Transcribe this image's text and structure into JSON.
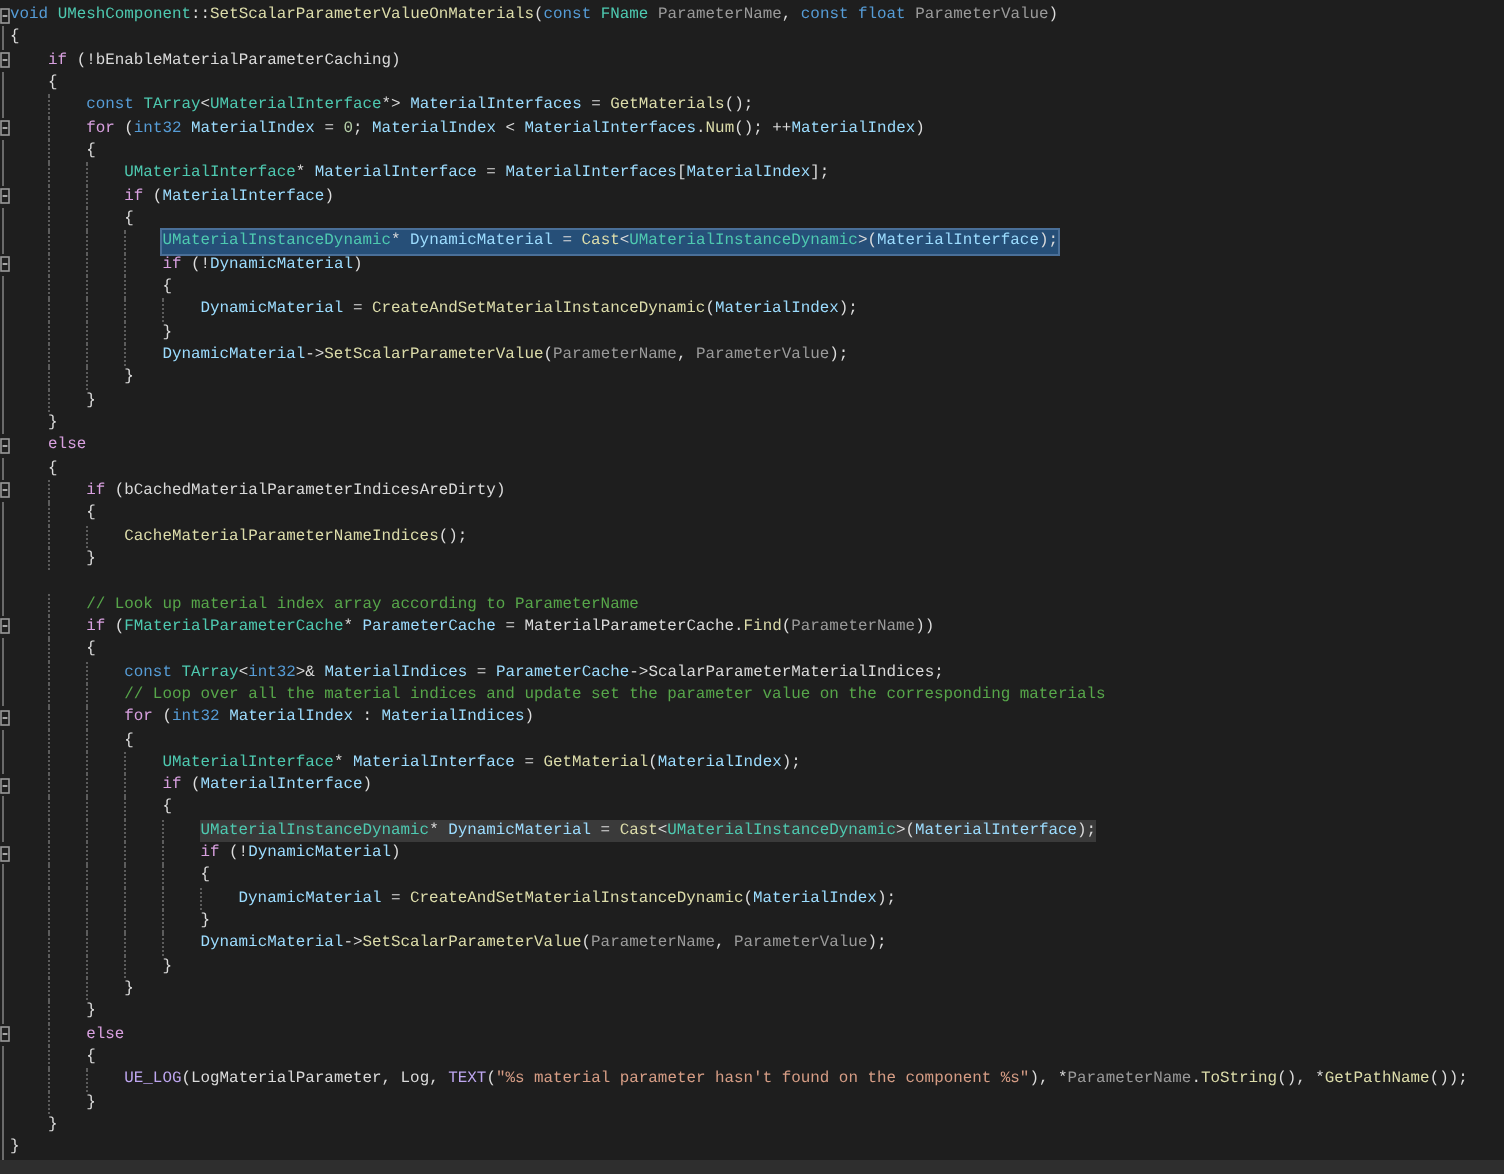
{
  "editor": {
    "lines": [
      {
        "foldable": true,
        "selected": false,
        "highlighted": false,
        "tokens": [
          {
            "kind": "keyword",
            "text": "void "
          },
          {
            "kind": "type",
            "text": "UMeshComponent"
          },
          {
            "kind": "plain",
            "text": "::"
          },
          {
            "kind": "function",
            "text": "SetScalarParameterValueOnMaterials"
          },
          {
            "kind": "plain",
            "text": "("
          },
          {
            "kind": "keyword",
            "text": "const "
          },
          {
            "kind": "type",
            "text": "FName "
          },
          {
            "kind": "parameter",
            "text": "ParameterName"
          },
          {
            "kind": "plain",
            "text": ", "
          },
          {
            "kind": "keyword",
            "text": "const float "
          },
          {
            "kind": "parameter",
            "text": "ParameterValue"
          },
          {
            "kind": "plain",
            "text": ")"
          }
        ]
      },
      {
        "foldable": false,
        "selected": false,
        "highlighted": false,
        "tokens": [
          {
            "kind": "plain",
            "text": "{"
          }
        ],
        "children": [
          {
            "foldable": true,
            "selected": false,
            "highlighted": false,
            "tokens": [
              {
                "kind": "control",
                "text": "if"
              },
              {
                "kind": "plain",
                "text": " (!"
              },
              {
                "kind": "field",
                "text": "bEnableMaterialParameterCaching"
              },
              {
                "kind": "plain",
                "text": ")"
              }
            ]
          },
          {
            "foldable": false,
            "selected": false,
            "highlighted": false,
            "tokens": [
              {
                "kind": "plain",
                "text": "{"
              }
            ],
            "children": [
              {
                "foldable": false,
                "selected": false,
                "highlighted": false,
                "tokens": [
                  {
                    "kind": "keyword",
                    "text": "const "
                  },
                  {
                    "kind": "type",
                    "text": "TArray"
                  },
                  {
                    "kind": "plain",
                    "text": "<"
                  },
                  {
                    "kind": "type",
                    "text": "UMaterialInterface"
                  },
                  {
                    "kind": "plain",
                    "text": "*> "
                  },
                  {
                    "kind": "variable",
                    "text": "MaterialInterfaces"
                  },
                  {
                    "kind": "plain",
                    "text": " = "
                  },
                  {
                    "kind": "function",
                    "text": "GetMaterials"
                  },
                  {
                    "kind": "plain",
                    "text": "();"
                  }
                ]
              },
              {
                "foldable": true,
                "selected": false,
                "highlighted": false,
                "tokens": [
                  {
                    "kind": "control",
                    "text": "for"
                  },
                  {
                    "kind": "plain",
                    "text": " ("
                  },
                  {
                    "kind": "keyword",
                    "text": "int32 "
                  },
                  {
                    "kind": "variable",
                    "text": "MaterialIndex"
                  },
                  {
                    "kind": "plain",
                    "text": " = "
                  },
                  {
                    "kind": "number",
                    "text": "0"
                  },
                  {
                    "kind": "plain",
                    "text": "; "
                  },
                  {
                    "kind": "variable",
                    "text": "MaterialIndex"
                  },
                  {
                    "kind": "plain",
                    "text": " < "
                  },
                  {
                    "kind": "variable",
                    "text": "MaterialInterfaces"
                  },
                  {
                    "kind": "plain",
                    "text": "."
                  },
                  {
                    "kind": "function",
                    "text": "Num"
                  },
                  {
                    "kind": "plain",
                    "text": "(); ++"
                  },
                  {
                    "kind": "variable",
                    "text": "MaterialIndex"
                  },
                  {
                    "kind": "plain",
                    "text": ")"
                  }
                ]
              },
              {
                "foldable": false,
                "selected": false,
                "highlighted": false,
                "tokens": [
                  {
                    "kind": "plain",
                    "text": "{"
                  }
                ],
                "children": [
                  {
                    "foldable": false,
                    "selected": false,
                    "highlighted": false,
                    "tokens": [
                      {
                        "kind": "type",
                        "text": "UMaterialInterface"
                      },
                      {
                        "kind": "plain",
                        "text": "* "
                      },
                      {
                        "kind": "variable",
                        "text": "MaterialInterface"
                      },
                      {
                        "kind": "plain",
                        "text": " = "
                      },
                      {
                        "kind": "variable",
                        "text": "MaterialInterfaces"
                      },
                      {
                        "kind": "plain",
                        "text": "["
                      },
                      {
                        "kind": "variable",
                        "text": "MaterialIndex"
                      },
                      {
                        "kind": "plain",
                        "text": "];"
                      }
                    ]
                  },
                  {
                    "foldable": true,
                    "selected": false,
                    "highlighted": false,
                    "tokens": [
                      {
                        "kind": "control",
                        "text": "if"
                      },
                      {
                        "kind": "plain",
                        "text": " ("
                      },
                      {
                        "kind": "variable",
                        "text": "MaterialInterface"
                      },
                      {
                        "kind": "plain",
                        "text": ")"
                      }
                    ]
                  },
                  {
                    "foldable": false,
                    "selected": false,
                    "highlighted": false,
                    "tokens": [
                      {
                        "kind": "plain",
                        "text": "{"
                      }
                    ],
                    "children": [
                      {
                        "foldable": false,
                        "selected": true,
                        "highlighted": false,
                        "tokens": [
                          {
                            "kind": "type",
                            "text": "UMaterialInstanceDynamic"
                          },
                          {
                            "kind": "plain",
                            "text": "* "
                          },
                          {
                            "kind": "variable",
                            "text": "DynamicMaterial"
                          },
                          {
                            "kind": "plain",
                            "text": " = "
                          },
                          {
                            "kind": "function",
                            "text": "Cast"
                          },
                          {
                            "kind": "plain",
                            "text": "<"
                          },
                          {
                            "kind": "type",
                            "text": "UMaterialInstanceDynamic"
                          },
                          {
                            "kind": "plain",
                            "text": ">("
                          },
                          {
                            "kind": "variable",
                            "text": "MaterialInterface"
                          },
                          {
                            "kind": "plain",
                            "text": ");"
                          }
                        ]
                      },
                      {
                        "foldable": true,
                        "selected": false,
                        "highlighted": false,
                        "tokens": [
                          {
                            "kind": "control",
                            "text": "if"
                          },
                          {
                            "kind": "plain",
                            "text": " (!"
                          },
                          {
                            "kind": "variable",
                            "text": "DynamicMaterial"
                          },
                          {
                            "kind": "plain",
                            "text": ")"
                          }
                        ]
                      },
                      {
                        "foldable": false,
                        "selected": false,
                        "highlighted": false,
                        "tokens": [
                          {
                            "kind": "plain",
                            "text": "{"
                          }
                        ],
                        "children": [
                          {
                            "foldable": false,
                            "selected": false,
                            "highlighted": false,
                            "tokens": [
                              {
                                "kind": "variable",
                                "text": "DynamicMaterial"
                              },
                              {
                                "kind": "plain",
                                "text": " = "
                              },
                              {
                                "kind": "function",
                                "text": "CreateAndSetMaterialInstanceDynamic"
                              },
                              {
                                "kind": "plain",
                                "text": "("
                              },
                              {
                                "kind": "variable",
                                "text": "MaterialIndex"
                              },
                              {
                                "kind": "plain",
                                "text": ");"
                              }
                            ]
                          }
                        ]
                      },
                      {
                        "foldable": false,
                        "selected": false,
                        "highlighted": false,
                        "tokens": [
                          {
                            "kind": "plain",
                            "text": "}"
                          }
                        ]
                      },
                      {
                        "foldable": false,
                        "selected": false,
                        "highlighted": false,
                        "tokens": [
                          {
                            "kind": "variable",
                            "text": "DynamicMaterial"
                          },
                          {
                            "kind": "plain",
                            "text": "->"
                          },
                          {
                            "kind": "function",
                            "text": "SetScalarParameterValue"
                          },
                          {
                            "kind": "plain",
                            "text": "("
                          },
                          {
                            "kind": "parameter",
                            "text": "ParameterName"
                          },
                          {
                            "kind": "plain",
                            "text": ", "
                          },
                          {
                            "kind": "parameter",
                            "text": "ParameterValue"
                          },
                          {
                            "kind": "plain",
                            "text": ");"
                          }
                        ]
                      }
                    ]
                  },
                  {
                    "foldable": false,
                    "selected": false,
                    "highlighted": false,
                    "tokens": [
                      {
                        "kind": "plain",
                        "text": "}"
                      }
                    ]
                  }
                ]
              },
              {
                "foldable": false,
                "selected": false,
                "highlighted": false,
                "tokens": [
                  {
                    "kind": "plain",
                    "text": "}"
                  }
                ]
              }
            ]
          },
          {
            "foldable": false,
            "selected": false,
            "highlighted": false,
            "tokens": [
              {
                "kind": "plain",
                "text": "}"
              }
            ]
          },
          {
            "foldable": true,
            "selected": false,
            "highlighted": false,
            "tokens": [
              {
                "kind": "control",
                "text": "else"
              }
            ]
          },
          {
            "foldable": false,
            "selected": false,
            "highlighted": false,
            "tokens": [
              {
                "kind": "plain",
                "text": "{"
              }
            ],
            "children": [
              {
                "foldable": true,
                "selected": false,
                "highlighted": false,
                "tokens": [
                  {
                    "kind": "control",
                    "text": "if"
                  },
                  {
                    "kind": "plain",
                    "text": " ("
                  },
                  {
                    "kind": "field",
                    "text": "bCachedMaterialParameterIndicesAreDirty"
                  },
                  {
                    "kind": "plain",
                    "text": ")"
                  }
                ]
              },
              {
                "foldable": false,
                "selected": false,
                "highlighted": false,
                "tokens": [
                  {
                    "kind": "plain",
                    "text": "{"
                  }
                ],
                "children": [
                  {
                    "foldable": false,
                    "selected": false,
                    "highlighted": false,
                    "tokens": [
                      {
                        "kind": "function",
                        "text": "CacheMaterialParameterNameIndices"
                      },
                      {
                        "kind": "plain",
                        "text": "();"
                      }
                    ]
                  }
                ]
              },
              {
                "foldable": false,
                "selected": false,
                "highlighted": false,
                "tokens": [
                  {
                    "kind": "plain",
                    "text": "}"
                  }
                ]
              },
              {
                "kind": "blank",
                "foldable": false
              },
              {
                "foldable": false,
                "selected": false,
                "highlighted": false,
                "tokens": [
                  {
                    "kind": "comment",
                    "text": "// Look up material index array according to ParameterName"
                  }
                ]
              },
              {
                "foldable": true,
                "selected": false,
                "highlighted": false,
                "tokens": [
                  {
                    "kind": "control",
                    "text": "if"
                  },
                  {
                    "kind": "plain",
                    "text": " ("
                  },
                  {
                    "kind": "type",
                    "text": "FMaterialParameterCache"
                  },
                  {
                    "kind": "plain",
                    "text": "* "
                  },
                  {
                    "kind": "variable",
                    "text": "ParameterCache"
                  },
                  {
                    "kind": "plain",
                    "text": " = "
                  },
                  {
                    "kind": "field",
                    "text": "MaterialParameterCache"
                  },
                  {
                    "kind": "plain",
                    "text": "."
                  },
                  {
                    "kind": "function",
                    "text": "Find"
                  },
                  {
                    "kind": "plain",
                    "text": "("
                  },
                  {
                    "kind": "parameter",
                    "text": "ParameterName"
                  },
                  {
                    "kind": "plain",
                    "text": "))"
                  }
                ]
              },
              {
                "foldable": false,
                "selected": false,
                "highlighted": false,
                "tokens": [
                  {
                    "kind": "plain",
                    "text": "{"
                  }
                ],
                "children": [
                  {
                    "foldable": false,
                    "selected": false,
                    "highlighted": false,
                    "tokens": [
                      {
                        "kind": "keyword",
                        "text": "const "
                      },
                      {
                        "kind": "type",
                        "text": "TArray"
                      },
                      {
                        "kind": "plain",
                        "text": "<"
                      },
                      {
                        "kind": "keyword",
                        "text": "int32"
                      },
                      {
                        "kind": "plain",
                        "text": ">& "
                      },
                      {
                        "kind": "variable",
                        "text": "MaterialIndices"
                      },
                      {
                        "kind": "plain",
                        "text": " = "
                      },
                      {
                        "kind": "variable",
                        "text": "ParameterCache"
                      },
                      {
                        "kind": "plain",
                        "text": "->"
                      },
                      {
                        "kind": "field",
                        "text": "ScalarParameterMaterialIndices"
                      },
                      {
                        "kind": "plain",
                        "text": ";"
                      }
                    ]
                  },
                  {
                    "foldable": false,
                    "selected": false,
                    "highlighted": false,
                    "tokens": [
                      {
                        "kind": "comment",
                        "text": "// Loop over all the material indices and update set the parameter value on the corresponding materials"
                      }
                    ]
                  },
                  {
                    "foldable": true,
                    "selected": false,
                    "highlighted": false,
                    "tokens": [
                      {
                        "kind": "control",
                        "text": "for"
                      },
                      {
                        "kind": "plain",
                        "text": " ("
                      },
                      {
                        "kind": "keyword",
                        "text": "int32 "
                      },
                      {
                        "kind": "variable",
                        "text": "MaterialIndex"
                      },
                      {
                        "kind": "plain",
                        "text": " : "
                      },
                      {
                        "kind": "variable",
                        "text": "MaterialIndices"
                      },
                      {
                        "kind": "plain",
                        "text": ")"
                      }
                    ]
                  },
                  {
                    "foldable": false,
                    "selected": false,
                    "highlighted": false,
                    "tokens": [
                      {
                        "kind": "plain",
                        "text": "{"
                      }
                    ],
                    "children": [
                      {
                        "foldable": false,
                        "selected": false,
                        "highlighted": false,
                        "tokens": [
                          {
                            "kind": "type",
                            "text": "UMaterialInterface"
                          },
                          {
                            "kind": "plain",
                            "text": "* "
                          },
                          {
                            "kind": "variable",
                            "text": "MaterialInterface"
                          },
                          {
                            "kind": "plain",
                            "text": " = "
                          },
                          {
                            "kind": "function",
                            "text": "GetMaterial"
                          },
                          {
                            "kind": "plain",
                            "text": "("
                          },
                          {
                            "kind": "variable",
                            "text": "MaterialIndex"
                          },
                          {
                            "kind": "plain",
                            "text": ");"
                          }
                        ]
                      },
                      {
                        "foldable": true,
                        "selected": false,
                        "highlighted": false,
                        "tokens": [
                          {
                            "kind": "control",
                            "text": "if"
                          },
                          {
                            "kind": "plain",
                            "text": " ("
                          },
                          {
                            "kind": "variable",
                            "text": "MaterialInterface"
                          },
                          {
                            "kind": "plain",
                            "text": ")"
                          }
                        ]
                      },
                      {
                        "foldable": false,
                        "selected": false,
                        "highlighted": false,
                        "tokens": [
                          {
                            "kind": "plain",
                            "text": "{"
                          }
                        ],
                        "children": [
                          {
                            "foldable": false,
                            "selected": false,
                            "highlighted": true,
                            "tokens": [
                              {
                                "kind": "type",
                                "text": "UMaterialInstanceDynamic"
                              },
                              {
                                "kind": "plain",
                                "text": "* "
                              },
                              {
                                "kind": "variable",
                                "text": "DynamicMaterial"
                              },
                              {
                                "kind": "plain",
                                "text": " = "
                              },
                              {
                                "kind": "function",
                                "text": "Cast"
                              },
                              {
                                "kind": "plain",
                                "text": "<"
                              },
                              {
                                "kind": "type",
                                "text": "UMaterialInstanceDynamic"
                              },
                              {
                                "kind": "plain",
                                "text": ">("
                              },
                              {
                                "kind": "variable",
                                "text": "MaterialInterface"
                              },
                              {
                                "kind": "plain",
                                "text": ");"
                              }
                            ]
                          },
                          {
                            "foldable": true,
                            "selected": false,
                            "highlighted": false,
                            "tokens": [
                              {
                                "kind": "control",
                                "text": "if"
                              },
                              {
                                "kind": "plain",
                                "text": " (!"
                              },
                              {
                                "kind": "variable",
                                "text": "DynamicMaterial"
                              },
                              {
                                "kind": "plain",
                                "text": ")"
                              }
                            ]
                          },
                          {
                            "foldable": false,
                            "selected": false,
                            "highlighted": false,
                            "tokens": [
                              {
                                "kind": "plain",
                                "text": "{"
                              }
                            ],
                            "children": [
                              {
                                "foldable": false,
                                "selected": false,
                                "highlighted": false,
                                "tokens": [
                                  {
                                    "kind": "variable",
                                    "text": "DynamicMaterial"
                                  },
                                  {
                                    "kind": "plain",
                                    "text": " = "
                                  },
                                  {
                                    "kind": "function",
                                    "text": "CreateAndSetMaterialInstanceDynamic"
                                  },
                                  {
                                    "kind": "plain",
                                    "text": "("
                                  },
                                  {
                                    "kind": "variable",
                                    "text": "MaterialIndex"
                                  },
                                  {
                                    "kind": "plain",
                                    "text": ");"
                                  }
                                ]
                              }
                            ]
                          },
                          {
                            "foldable": false,
                            "selected": false,
                            "highlighted": false,
                            "tokens": [
                              {
                                "kind": "plain",
                                "text": "}"
                              }
                            ]
                          },
                          {
                            "foldable": false,
                            "selected": false,
                            "highlighted": false,
                            "tokens": [
                              {
                                "kind": "variable",
                                "text": "DynamicMaterial"
                              },
                              {
                                "kind": "plain",
                                "text": "->"
                              },
                              {
                                "kind": "function",
                                "text": "SetScalarParameterValue"
                              },
                              {
                                "kind": "plain",
                                "text": "("
                              },
                              {
                                "kind": "parameter",
                                "text": "ParameterName"
                              },
                              {
                                "kind": "plain",
                                "text": ", "
                              },
                              {
                                "kind": "parameter",
                                "text": "ParameterValue"
                              },
                              {
                                "kind": "plain",
                                "text": ");"
                              }
                            ]
                          }
                        ]
                      },
                      {
                        "foldable": false,
                        "selected": false,
                        "highlighted": false,
                        "tokens": [
                          {
                            "kind": "plain",
                            "text": "}"
                          }
                        ]
                      }
                    ]
                  },
                  {
                    "foldable": false,
                    "selected": false,
                    "highlighted": false,
                    "tokens": [
                      {
                        "kind": "plain",
                        "text": "}"
                      }
                    ]
                  }
                ]
              },
              {
                "foldable": false,
                "selected": false,
                "highlighted": false,
                "tokens": [
                  {
                    "kind": "plain",
                    "text": "}"
                  }
                ]
              },
              {
                "foldable": true,
                "selected": false,
                "highlighted": false,
                "tokens": [
                  {
                    "kind": "control",
                    "text": "else"
                  }
                ]
              },
              {
                "foldable": false,
                "selected": false,
                "highlighted": false,
                "tokens": [
                  {
                    "kind": "plain",
                    "text": "{"
                  }
                ],
                "children": [
                  {
                    "foldable": false,
                    "selected": false,
                    "highlighted": false,
                    "tokens": [
                      {
                        "kind": "macro",
                        "text": "UE_LOG"
                      },
                      {
                        "kind": "plain",
                        "text": "("
                      },
                      {
                        "kind": "field",
                        "text": "LogMaterialParameter"
                      },
                      {
                        "kind": "plain",
                        "text": ", "
                      },
                      {
                        "kind": "field",
                        "text": "Log"
                      },
                      {
                        "kind": "plain",
                        "text": ", "
                      },
                      {
                        "kind": "macro",
                        "text": "TEXT"
                      },
                      {
                        "kind": "plain",
                        "text": "("
                      },
                      {
                        "kind": "string",
                        "text": "\"%s material parameter hasn't found on the component %s\""
                      },
                      {
                        "kind": "plain",
                        "text": "), *"
                      },
                      {
                        "kind": "parameter",
                        "text": "ParameterName"
                      },
                      {
                        "kind": "plain",
                        "text": "."
                      },
                      {
                        "kind": "function",
                        "text": "ToString"
                      },
                      {
                        "kind": "plain",
                        "text": "(), *"
                      },
                      {
                        "kind": "function",
                        "text": "GetPathName"
                      },
                      {
                        "kind": "plain",
                        "text": "());"
                      }
                    ]
                  }
                ]
              },
              {
                "foldable": false,
                "selected": false,
                "highlighted": false,
                "tokens": [
                  {
                    "kind": "plain",
                    "text": "}"
                  }
                ]
              }
            ]
          },
          {
            "foldable": false,
            "selected": false,
            "highlighted": false,
            "tokens": [
              {
                "kind": "plain",
                "text": "}"
              }
            ]
          }
        ]
      },
      {
        "foldable": false,
        "selected": false,
        "highlighted": false,
        "tokens": [
          {
            "kind": "plain",
            "text": "}"
          }
        ]
      }
    ]
  }
}
